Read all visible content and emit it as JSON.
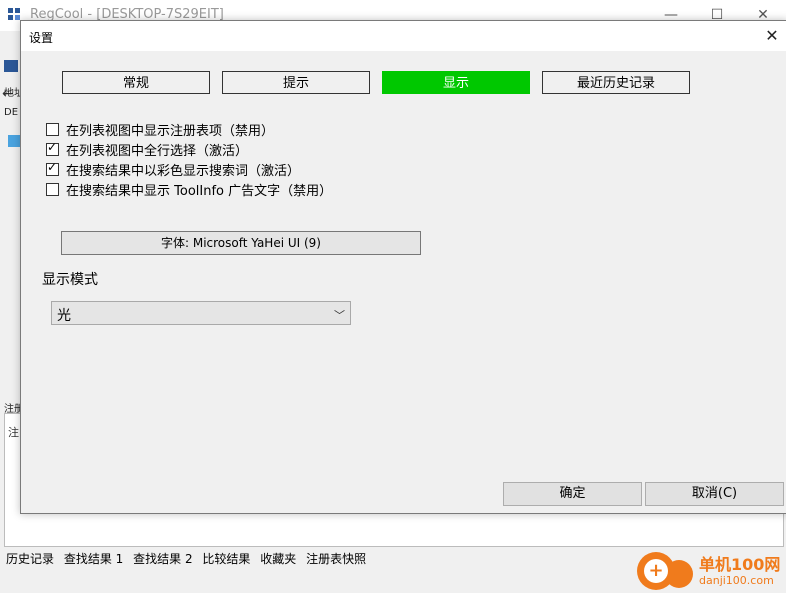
{
  "main_window": {
    "title": "RegCool - [DESKTOP-7S29EIT]",
    "left_labels": [
      "地址",
      "DE",
      "注册",
      "注"
    ],
    "bottom_tabs": [
      "历史记录",
      "查找结果 1",
      "查找结果 2",
      "比较结果",
      "收藏夹",
      "注册表快照"
    ],
    "window_buttons": {
      "minimize": "—",
      "maximize": "☐",
      "close": "✕"
    }
  },
  "dialog": {
    "title": "设置",
    "close_glyph": "✕",
    "tabs": [
      {
        "label": "常规",
        "active": false
      },
      {
        "label": "提示",
        "active": false
      },
      {
        "label": "显示",
        "active": true
      },
      {
        "label": "最近历史记录",
        "active": false
      }
    ],
    "options": [
      {
        "label": "在列表视图中显示注册表项（禁用）",
        "checked": false
      },
      {
        "label": "在列表视图中全行选择（激活）",
        "checked": true
      },
      {
        "label": "在搜索结果中以彩色显示搜索词（激活）",
        "checked": true
      },
      {
        "label": "在搜索结果中显示 ToolInfo 广告文字（禁用）",
        "checked": false
      }
    ],
    "font_button": "字体: Microsoft YaHei UI (9)",
    "display_mode_label": "显示模式",
    "display_mode_value": "光",
    "ok_button": "确定",
    "cancel_button": "取消(C)"
  },
  "watermark": {
    "title": "单机100网",
    "url": "danji100.com"
  },
  "colors": {
    "active_tab": "#00c800",
    "watermark": "#f07b1c"
  },
  "icons": [
    "app-icon",
    "close-icon",
    "chevron-down-icon",
    "checkbox-icon",
    "watermark-logo"
  ]
}
